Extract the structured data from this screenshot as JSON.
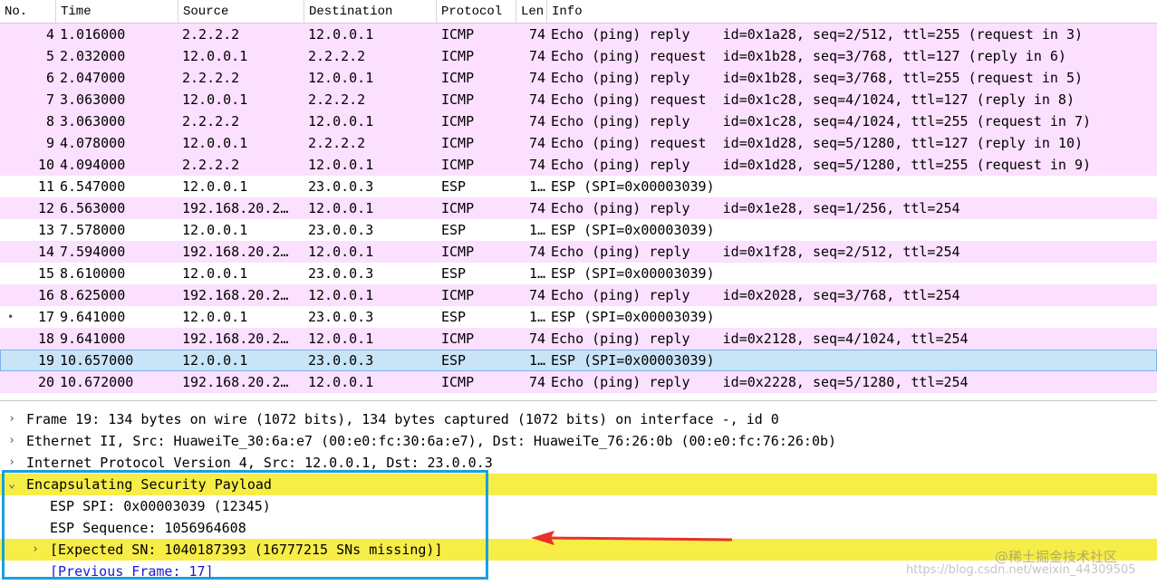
{
  "colors": {
    "icmp_row": "#fce0ff",
    "esp_row": "#ffffff",
    "selected_row": "#c9e4f7",
    "highlight_yellow": "#f7ed47",
    "focus_box": "#1aa0dc",
    "annotation_arrow": "#e8312a"
  },
  "packet_list": {
    "columns": [
      "No.",
      "Time",
      "Source",
      "Destination",
      "Protocol",
      "Len",
      "Info"
    ],
    "rows": [
      {
        "no": "4",
        "time": "1.016000",
        "src": "2.2.2.2",
        "dst": "12.0.0.1",
        "proto": "ICMP",
        "len": "74",
        "info": "Echo (ping) reply    id=0x1a28, seq=2/512, ttl=255 (request in 3)",
        "kind": "icmp"
      },
      {
        "no": "5",
        "time": "2.032000",
        "src": "12.0.0.1",
        "dst": "2.2.2.2",
        "proto": "ICMP",
        "len": "74",
        "info": "Echo (ping) request  id=0x1b28, seq=3/768, ttl=127 (reply in 6)",
        "kind": "icmp"
      },
      {
        "no": "6",
        "time": "2.047000",
        "src": "2.2.2.2",
        "dst": "12.0.0.1",
        "proto": "ICMP",
        "len": "74",
        "info": "Echo (ping) reply    id=0x1b28, seq=3/768, ttl=255 (request in 5)",
        "kind": "icmp"
      },
      {
        "no": "7",
        "time": "3.063000",
        "src": "12.0.0.1",
        "dst": "2.2.2.2",
        "proto": "ICMP",
        "len": "74",
        "info": "Echo (ping) request  id=0x1c28, seq=4/1024, ttl=127 (reply in 8)",
        "kind": "icmp"
      },
      {
        "no": "8",
        "time": "3.063000",
        "src": "2.2.2.2",
        "dst": "12.0.0.1",
        "proto": "ICMP",
        "len": "74",
        "info": "Echo (ping) reply    id=0x1c28, seq=4/1024, ttl=255 (request in 7)",
        "kind": "icmp"
      },
      {
        "no": "9",
        "time": "4.078000",
        "src": "12.0.0.1",
        "dst": "2.2.2.2",
        "proto": "ICMP",
        "len": "74",
        "info": "Echo (ping) request  id=0x1d28, seq=5/1280, ttl=127 (reply in 10)",
        "kind": "icmp"
      },
      {
        "no": "10",
        "time": "4.094000",
        "src": "2.2.2.2",
        "dst": "12.0.0.1",
        "proto": "ICMP",
        "len": "74",
        "info": "Echo (ping) reply    id=0x1d28, seq=5/1280, ttl=255 (request in 9)",
        "kind": "icmp"
      },
      {
        "no": "11",
        "time": "6.547000",
        "src": "12.0.0.1",
        "dst": "23.0.0.3",
        "proto": "ESP",
        "len": "1…",
        "info": "ESP (SPI=0x00003039)",
        "kind": "esp"
      },
      {
        "no": "12",
        "time": "6.563000",
        "src": "192.168.20.2…",
        "dst": "12.0.0.1",
        "proto": "ICMP",
        "len": "74",
        "info": "Echo (ping) reply    id=0x1e28, seq=1/256, ttl=254",
        "kind": "icmp"
      },
      {
        "no": "13",
        "time": "7.578000",
        "src": "12.0.0.1",
        "dst": "23.0.0.3",
        "proto": "ESP",
        "len": "1…",
        "info": "ESP (SPI=0x00003039)",
        "kind": "esp"
      },
      {
        "no": "14",
        "time": "7.594000",
        "src": "192.168.20.2…",
        "dst": "12.0.0.1",
        "proto": "ICMP",
        "len": "74",
        "info": "Echo (ping) reply    id=0x1f28, seq=2/512, ttl=254",
        "kind": "icmp"
      },
      {
        "no": "15",
        "time": "8.610000",
        "src": "12.0.0.1",
        "dst": "23.0.0.3",
        "proto": "ESP",
        "len": "1…",
        "info": "ESP (SPI=0x00003039)",
        "kind": "esp"
      },
      {
        "no": "16",
        "time": "8.625000",
        "src": "192.168.20.2…",
        "dst": "12.0.0.1",
        "proto": "ICMP",
        "len": "74",
        "info": "Echo (ping) reply    id=0x2028, seq=3/768, ttl=254",
        "kind": "icmp"
      },
      {
        "no": "17",
        "time": "9.641000",
        "src": "12.0.0.1",
        "dst": "23.0.0.3",
        "proto": "ESP",
        "len": "1…",
        "info": "ESP (SPI=0x00003039)",
        "kind": "esp",
        "mark": "•"
      },
      {
        "no": "18",
        "time": "9.641000",
        "src": "192.168.20.2…",
        "dst": "12.0.0.1",
        "proto": "ICMP",
        "len": "74",
        "info": "Echo (ping) reply    id=0x2128, seq=4/1024, ttl=254",
        "kind": "icmp"
      },
      {
        "no": "19",
        "time": "10.657000",
        "src": "12.0.0.1",
        "dst": "23.0.0.3",
        "proto": "ESP",
        "len": "1…",
        "info": "ESP (SPI=0x00003039)",
        "kind": "selected"
      },
      {
        "no": "20",
        "time": "10.672000",
        "src": "192.168.20.2…",
        "dst": "12.0.0.1",
        "proto": "ICMP",
        "len": "74",
        "info": "Echo (ping) reply    id=0x2228, seq=5/1280, ttl=254",
        "kind": "icmp"
      }
    ]
  },
  "details": {
    "rows": [
      {
        "level": 0,
        "arrow": "›",
        "text": "Frame 19: 134 bytes on wire (1072 bits), 134 bytes captured (1072 bits) on interface -, id 0",
        "hl": false,
        "link": false,
        "name": "detail-frame"
      },
      {
        "level": 0,
        "arrow": "›",
        "text": "Ethernet II, Src: HuaweiTe_30:6a:e7 (00:e0:fc:30:6a:e7), Dst: HuaweiTe_76:26:0b (00:e0:fc:76:26:0b)",
        "hl": false,
        "link": false,
        "name": "detail-ethernet"
      },
      {
        "level": 0,
        "arrow": "›",
        "text": "Internet Protocol Version 4, Src: 12.0.0.1, Dst: 23.0.0.3",
        "hl": false,
        "link": false,
        "name": "detail-ipv4"
      },
      {
        "level": 0,
        "arrow": "⌄",
        "text": "Encapsulating Security Payload",
        "hl": true,
        "link": false,
        "name": "detail-esp"
      },
      {
        "level": 1,
        "arrow": "",
        "text": "ESP SPI: 0x00003039 (12345)",
        "hl": false,
        "link": false,
        "name": "detail-esp-spi"
      },
      {
        "level": 1,
        "arrow": "",
        "text": "ESP Sequence: 1056964608",
        "hl": false,
        "link": false,
        "name": "detail-esp-sequence"
      },
      {
        "level": 1,
        "arrow": "›",
        "text": "[Expected SN: 1040187393 (16777215 SNs missing)]",
        "hl": true,
        "link": false,
        "name": "detail-expected-sn"
      },
      {
        "level": 1,
        "arrow": "",
        "text": "[Previous Frame: 17]",
        "hl": false,
        "link": true,
        "name": "detail-previous-frame"
      }
    ]
  },
  "watermark": {
    "line1": "@稀土掘金技术社区",
    "line2": "https://blog.csdn.net/weixin_44309505"
  }
}
